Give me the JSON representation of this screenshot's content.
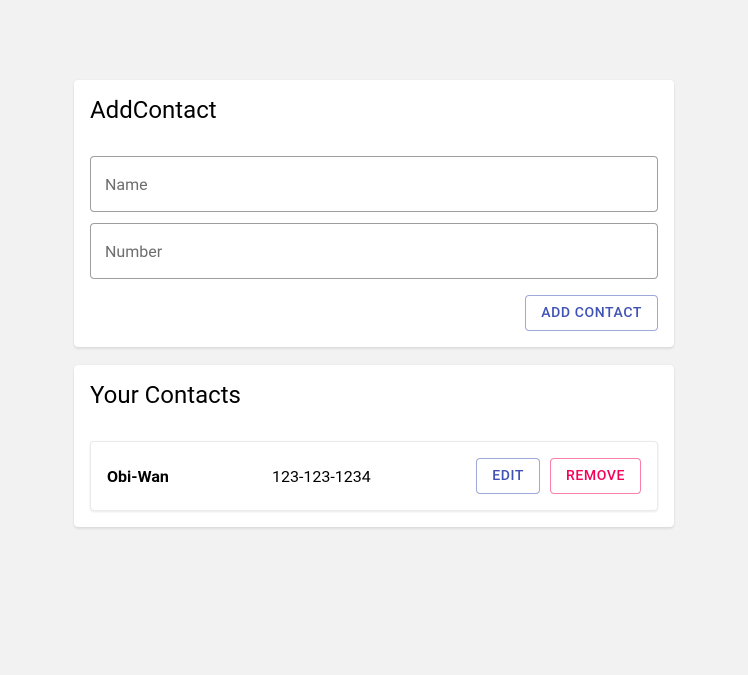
{
  "addContact": {
    "title": "AddContact",
    "namePlaceholder": "Name",
    "numberPlaceholder": "Number",
    "nameValue": "",
    "numberValue": "",
    "submitLabel": "Add Contact"
  },
  "contactsSection": {
    "title": "Your Contacts"
  },
  "contacts": [
    {
      "name": "Obi-Wan",
      "number": "123-123-1234",
      "editLabel": "Edit",
      "removeLabel": "Remove"
    }
  ]
}
